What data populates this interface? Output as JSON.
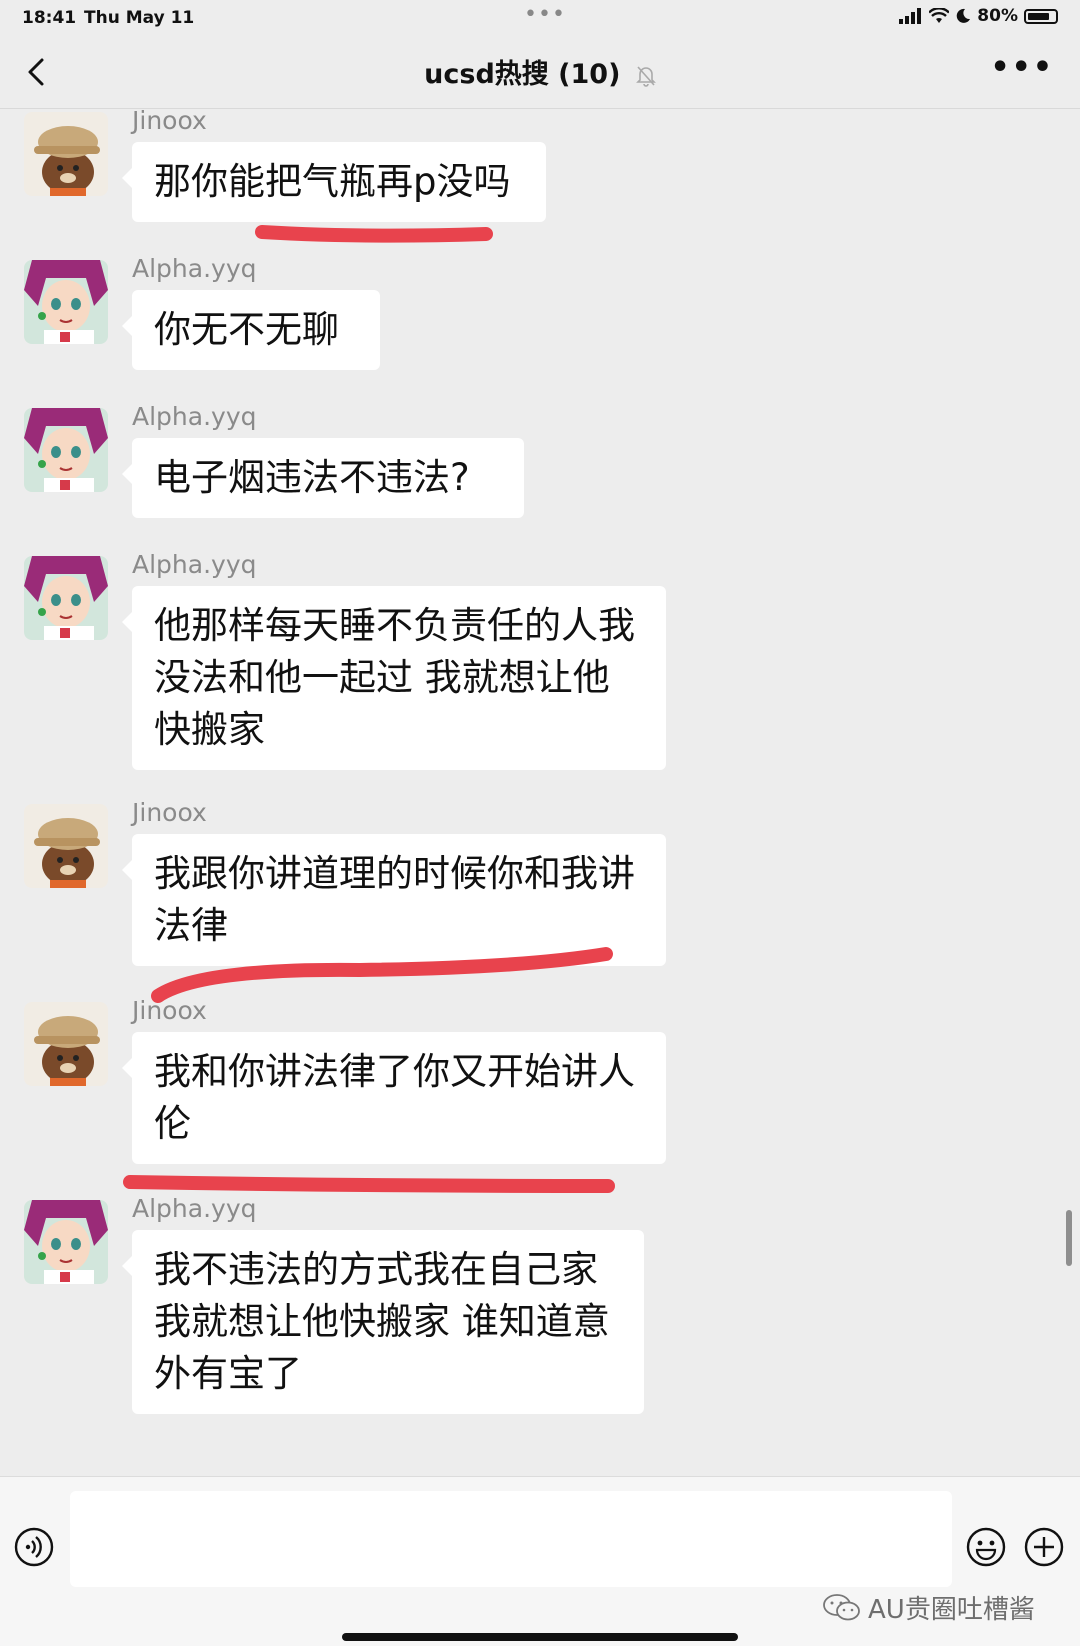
{
  "status_bar": {
    "time": "18:41",
    "date": "Thu May 11",
    "battery": "80%",
    "battery_level": 0.8
  },
  "nav": {
    "title": "ucsd热搜 (10)"
  },
  "messages": [
    {
      "sender": "Jinoox",
      "avatar": "bear-avatar",
      "lines": [
        "那你能把气瓶再p没吗"
      ],
      "highlighted": true
    },
    {
      "sender": "Alpha.yyq",
      "avatar": "anime-avatar",
      "lines": [
        "你无不无聊"
      ],
      "highlighted": false
    },
    {
      "sender": "Alpha.yyq",
      "avatar": "anime-avatar",
      "lines": [
        "电子烟违法不违法?"
      ],
      "highlighted": false
    },
    {
      "sender": "Alpha.yyq",
      "avatar": "anime-avatar",
      "lines": [
        "他那样每天睡不负责任的人我",
        "没法和他一起过 我就想让他",
        "快搬家"
      ],
      "highlighted": false
    },
    {
      "sender": "Jinoox",
      "avatar": "bear-avatar",
      "lines": [
        "我跟你讲道理的时候你和我讲",
        "法律"
      ],
      "highlighted": true
    },
    {
      "sender": "Jinoox",
      "avatar": "bear-avatar",
      "lines": [
        "我和你讲法律了你又开始讲人",
        "伦"
      ],
      "highlighted": true
    },
    {
      "sender": "Alpha.yyq",
      "avatar": "anime-avatar",
      "lines": [
        "我不违法的方式我在自己家",
        "我就想让他快搬家 谁知道意",
        "外有宝了"
      ],
      "highlighted": false
    }
  ],
  "input": {
    "value": ""
  },
  "watermark": "AU贵圈吐槽酱",
  "colors": {
    "background": "#ededed",
    "bubble": "#ffffff",
    "highlight": "#e8434d"
  }
}
